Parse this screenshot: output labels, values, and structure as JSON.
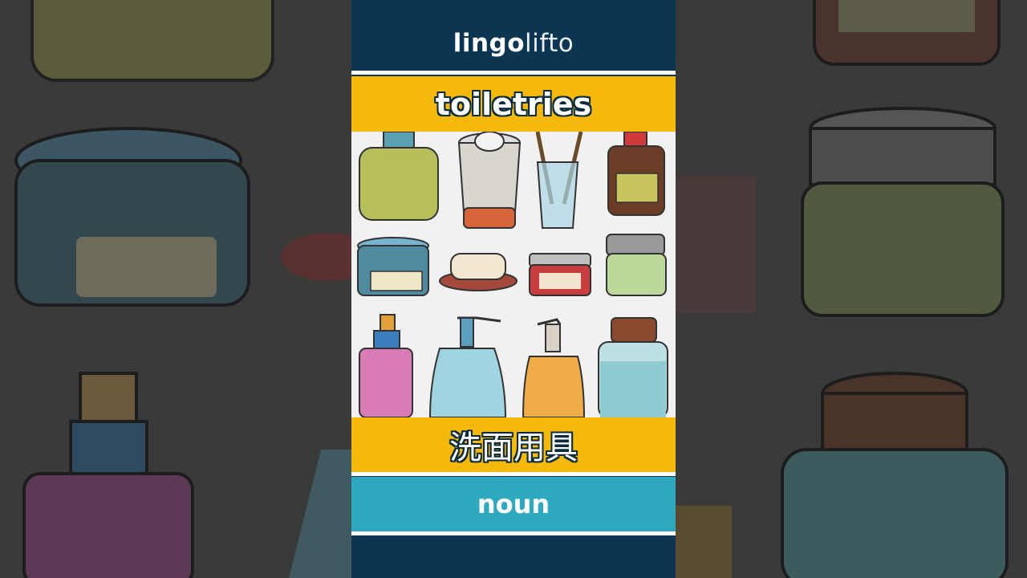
{
  "brand": {
    "logo_part1": "lingo",
    "logo_part2": "lifto",
    "accent_color": "#f08a24"
  },
  "card": {
    "word": "toiletries",
    "translation": "洗面用具",
    "part_of_speech": "noun"
  },
  "colors": {
    "header_bg": "#0b3550",
    "word_band": "#f5b80d",
    "pos_band": "#2ea9bf",
    "illustration_bg": "#f1f1f1"
  },
  "illustration": {
    "items": [
      "olive-bottle-icon",
      "cup-icon",
      "toothbrush-glass-icon",
      "brown-bottle-icon",
      "blue-jar-icon",
      "soap-dish-icon",
      "red-jar-icon",
      "green-jar-icon",
      "pink-spray-bottle-icon",
      "blue-pump-bottle-icon",
      "orange-pump-bottle-icon",
      "teal-jar-bottle-icon"
    ]
  }
}
